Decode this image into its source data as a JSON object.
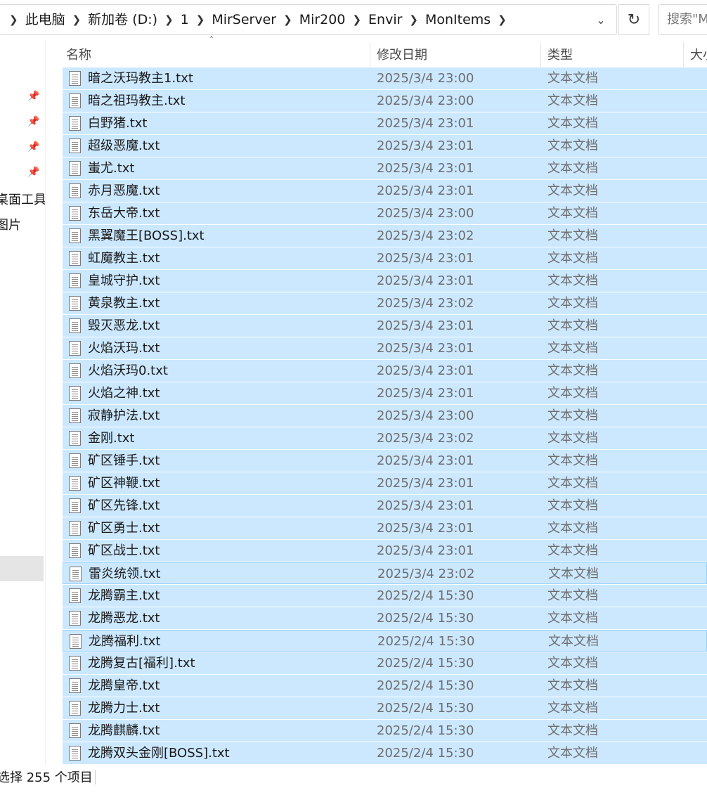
{
  "breadcrumb": {
    "items": [
      "此电脑",
      "新加卷 (D:)",
      "1",
      "MirServer",
      "Mir200",
      "Envir",
      "MonItems"
    ],
    "separator": ">"
  },
  "search": {
    "placeholder": "搜索\"MonItems\""
  },
  "nav": {
    "partial_items": [
      "桌面工具",
      "图片"
    ]
  },
  "columns": {
    "name": "名称",
    "date": "修改日期",
    "type": "类型",
    "size": "大小"
  },
  "files": [
    {
      "name": "暗之沃玛教主1.txt",
      "date": "2025/3/4 23:00",
      "type": "文本文档"
    },
    {
      "name": "暗之祖玛教主.txt",
      "date": "2025/3/4 23:00",
      "type": "文本文档"
    },
    {
      "name": "白野猪.txt",
      "date": "2025/3/4 23:01",
      "type": "文本文档"
    },
    {
      "name": "超级恶魔.txt",
      "date": "2025/3/4 23:01",
      "type": "文本文档"
    },
    {
      "name": "蚩尤.txt",
      "date": "2025/3/4 23:01",
      "type": "文本文档"
    },
    {
      "name": "赤月恶魔.txt",
      "date": "2025/3/4 23:01",
      "type": "文本文档"
    },
    {
      "name": "东岳大帝.txt",
      "date": "2025/3/4 23:00",
      "type": "文本文档"
    },
    {
      "name": "黑翼魔王[BOSS].txt",
      "date": "2025/3/4 23:02",
      "type": "文本文档"
    },
    {
      "name": "虹魔教主.txt",
      "date": "2025/3/4 23:01",
      "type": "文本文档"
    },
    {
      "name": "皇城守护.txt",
      "date": "2025/3/4 23:01",
      "type": "文本文档"
    },
    {
      "name": "黄泉教主.txt",
      "date": "2025/3/4 23:02",
      "type": "文本文档"
    },
    {
      "name": "毁灭恶龙.txt",
      "date": "2025/3/4 23:01",
      "type": "文本文档"
    },
    {
      "name": "火焰沃玛.txt",
      "date": "2025/3/4 23:01",
      "type": "文本文档"
    },
    {
      "name": "火焰沃玛0.txt",
      "date": "2025/3/4 23:01",
      "type": "文本文档"
    },
    {
      "name": "火焰之神.txt",
      "date": "2025/3/4 23:01",
      "type": "文本文档"
    },
    {
      "name": "寂静护法.txt",
      "date": "2025/3/4 23:00",
      "type": "文本文档"
    },
    {
      "name": "金刚.txt",
      "date": "2025/3/4 23:02",
      "type": "文本文档"
    },
    {
      "name": "矿区锤手.txt",
      "date": "2025/3/4 23:01",
      "type": "文本文档"
    },
    {
      "name": "矿区神鞭.txt",
      "date": "2025/3/4 23:01",
      "type": "文本文档"
    },
    {
      "name": "矿区先锋.txt",
      "date": "2025/3/4 23:01",
      "type": "文本文档"
    },
    {
      "name": "矿区勇士.txt",
      "date": "2025/3/4 23:01",
      "type": "文本文档"
    },
    {
      "name": "矿区战士.txt",
      "date": "2025/3/4 23:01",
      "type": "文本文档"
    },
    {
      "name": "雷炎统领.txt",
      "date": "2025/3/4 23:02",
      "type": "文本文档"
    },
    {
      "name": "龙腾霸主.txt",
      "date": "2025/2/4 15:30",
      "type": "文本文档"
    },
    {
      "name": "龙腾恶龙.txt",
      "date": "2025/2/4 15:30",
      "type": "文本文档"
    },
    {
      "name": "龙腾福利.txt",
      "date": "2025/2/4 15:30",
      "type": "文本文档"
    },
    {
      "name": "龙腾复古[福利].txt",
      "date": "2025/2/4 15:30",
      "type": "文本文档"
    },
    {
      "name": "龙腾皇帝.txt",
      "date": "2025/2/4 15:30",
      "type": "文本文档"
    },
    {
      "name": "龙腾力士.txt",
      "date": "2025/2/4 15:30",
      "type": "文本文档"
    },
    {
      "name": "龙腾麒麟.txt",
      "date": "2025/2/4 15:30",
      "type": "文本文档"
    },
    {
      "name": "龙腾双头金刚[BOSS].txt",
      "date": "2025/2/4 15:30",
      "type": "文本文档"
    }
  ],
  "status": {
    "selection": "选择 255 个项目"
  },
  "colors": {
    "selection": "#cce8ff",
    "selection_border": "#99d1ff"
  }
}
